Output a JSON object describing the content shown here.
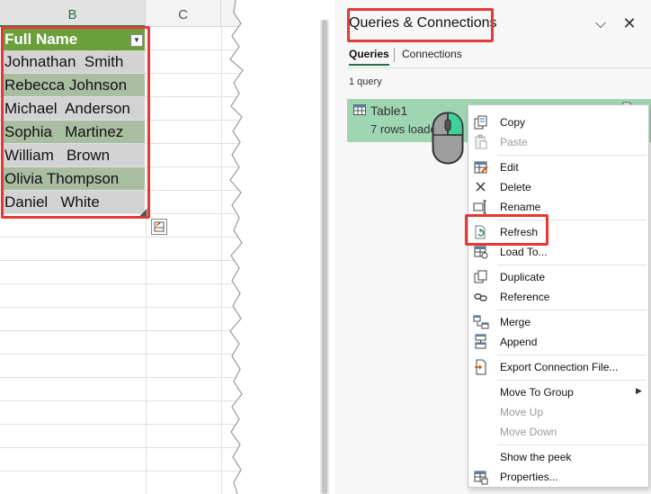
{
  "sheet": {
    "columns": [
      "B",
      "C"
    ],
    "table_header": "Full Name",
    "names": [
      "Johnathan  Smith",
      "Rebecca Johnson",
      "Michael  Anderson",
      "Sophia   Martinez",
      "William   Brown",
      "Olivia Thompson",
      "Daniel   White"
    ]
  },
  "pane": {
    "title": "Queries & Connections",
    "tabs": [
      "Queries",
      "Connections"
    ],
    "query_count": "1 query",
    "query": {
      "name": "Table1",
      "status": "7 rows loaded."
    }
  },
  "menu": {
    "items": [
      {
        "label": "Copy",
        "disabled": false,
        "icon": "copy-icon"
      },
      {
        "label": "Paste",
        "disabled": true,
        "icon": "paste-icon"
      },
      {
        "label": "Edit",
        "disabled": false,
        "icon": "edit-icon"
      },
      {
        "label": "Delete",
        "disabled": false,
        "icon": "delete-icon"
      },
      {
        "label": "Rename",
        "disabled": false,
        "icon": "rename-icon"
      },
      {
        "label": "Refresh",
        "disabled": false,
        "icon": "refresh-icon"
      },
      {
        "label": "Load To...",
        "disabled": false,
        "icon": "load-to-icon"
      },
      {
        "label": "Duplicate",
        "disabled": false,
        "icon": "duplicate-icon"
      },
      {
        "label": "Reference",
        "disabled": false,
        "icon": "reference-icon"
      },
      {
        "label": "Merge",
        "disabled": false,
        "icon": "merge-icon"
      },
      {
        "label": "Append",
        "disabled": false,
        "icon": "append-icon"
      },
      {
        "label": "Export Connection File...",
        "disabled": false,
        "icon": "export-icon"
      },
      {
        "label": "Move To Group",
        "disabled": false,
        "icon": ""
      },
      {
        "label": "Move Up",
        "disabled": true,
        "icon": ""
      },
      {
        "label": "Move Down",
        "disabled": true,
        "icon": ""
      },
      {
        "label": "Show the peek",
        "disabled": false,
        "icon": ""
      },
      {
        "label": "Properties...",
        "disabled": false,
        "icon": "properties-icon"
      }
    ]
  },
  "colors": {
    "table_header": "#6a9f3c",
    "query_card": "#9ed6b2",
    "highlight_box": "#e53935",
    "accent": "#217346"
  }
}
